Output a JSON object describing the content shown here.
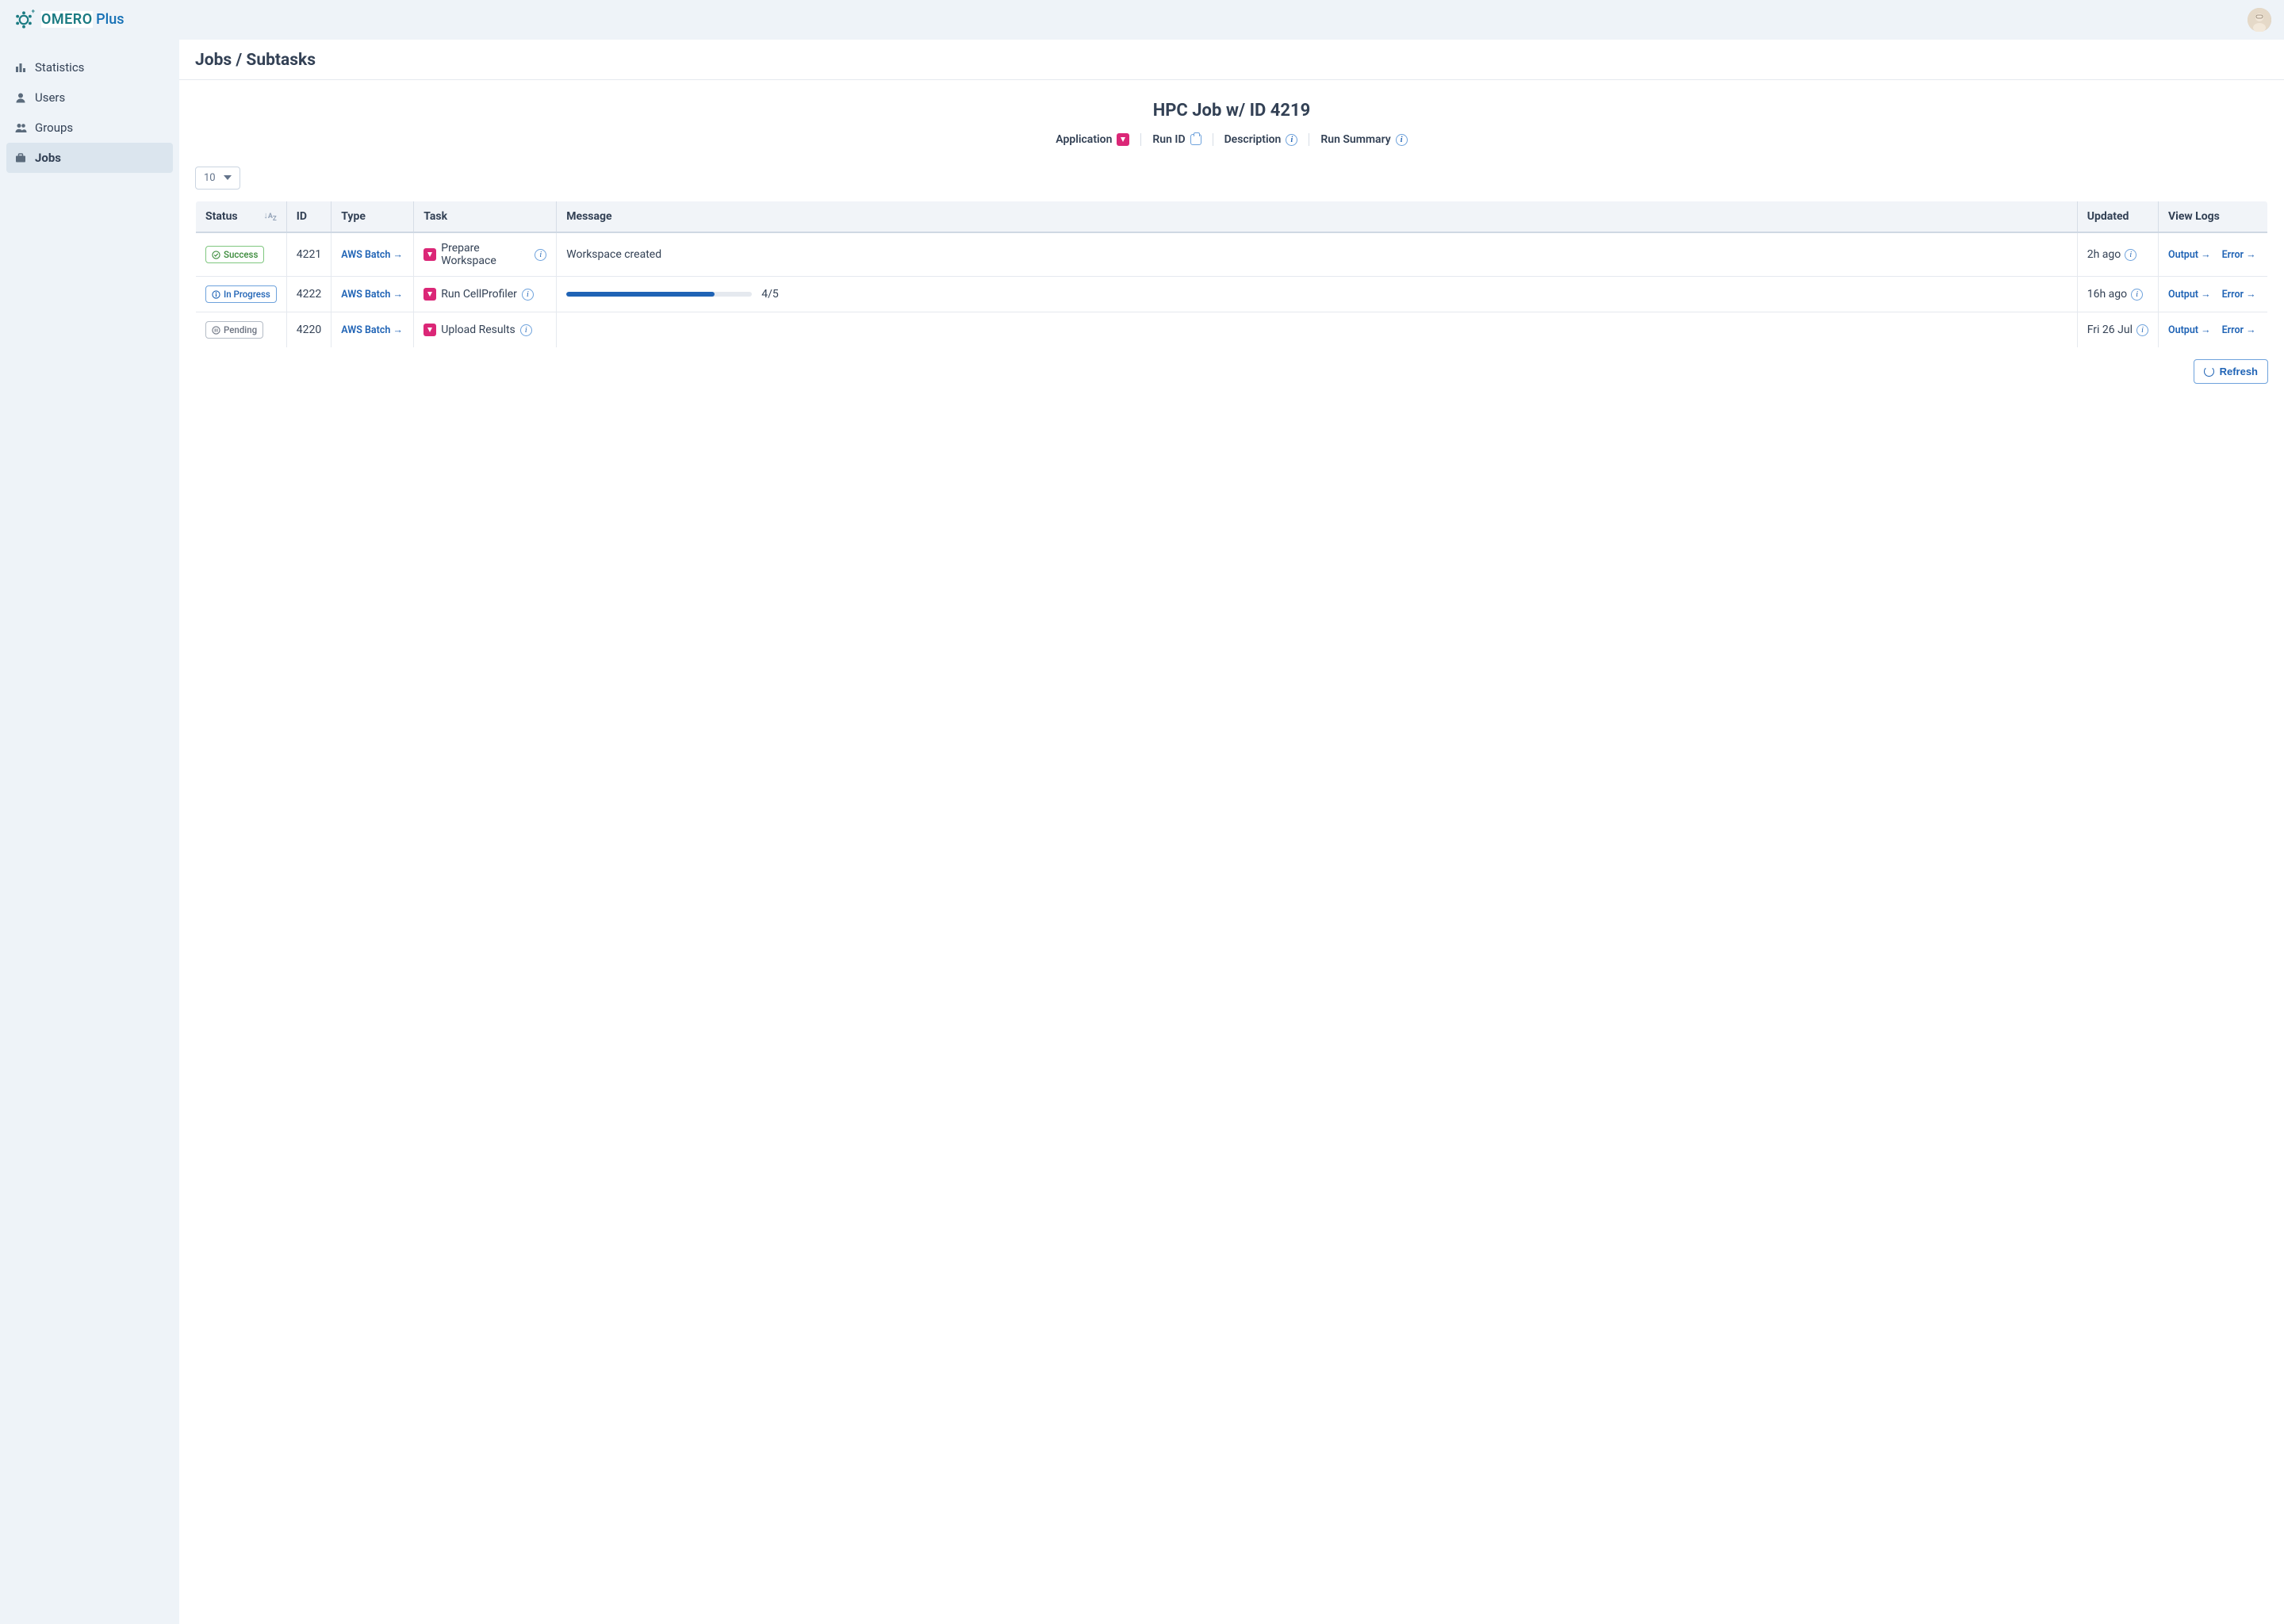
{
  "brand": {
    "main": "OMERO",
    "plus": "Plus"
  },
  "sidebar": {
    "items": [
      {
        "label": "Statistics"
      },
      {
        "label": "Users"
      },
      {
        "label": "Groups"
      },
      {
        "label": "Jobs"
      }
    ]
  },
  "breadcrumb": "Jobs / Subtasks",
  "job": {
    "title": "HPC Job w/ ID 4219",
    "meta": {
      "application": "Application",
      "run_id": "Run ID",
      "description": "Description",
      "run_summary": "Run Summary"
    }
  },
  "page_size": "10",
  "table": {
    "headers": {
      "status": "Status",
      "id": "ID",
      "type": "Type",
      "task": "Task",
      "message": "Message",
      "updated": "Updated",
      "logs": "View Logs"
    },
    "rows": [
      {
        "status_kind": "success",
        "status_label": "Success",
        "id": "4221",
        "type": "AWS Batch →",
        "task": "Prepare Workspace",
        "message_text": "Workspace created",
        "updated": "2h ago",
        "output": "Output →",
        "error": "Error →"
      },
      {
        "status_kind": "inprogress",
        "status_label": "In Progress",
        "id": "4222",
        "type": "AWS Batch →",
        "task": "Run CellProfiler",
        "progress_pct": 80,
        "progress_label": "4/5",
        "updated": "16h ago",
        "output": "Output →",
        "error": "Error →"
      },
      {
        "status_kind": "pending",
        "status_label": "Pending",
        "id": "4220",
        "type": "AWS Batch →",
        "task": "Upload Results",
        "updated": "Fri 26 Jul",
        "output": "Output →",
        "error": "Error →"
      }
    ]
  },
  "refresh_label": "Refresh"
}
